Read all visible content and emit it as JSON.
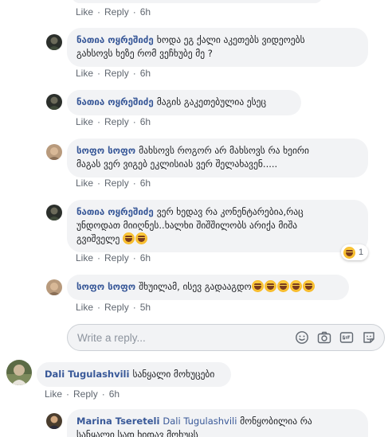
{
  "actions": {
    "like": "Like",
    "reply": "Reply",
    "separator": "·"
  },
  "top_comment_tail": {
    "time": "6h"
  },
  "comments": [
    {
      "author": "ნათია ოყრეშიძე",
      "line1": "ხოდა ეგ ქალი აკეთებს ვიდეოებს",
      "line2": "გახსოვს ხეზე რომ ვეჩხუბე მე ?",
      "time": "6h"
    },
    {
      "author": "ნათია ოყრეშიძე",
      "line1": "მაგის გაკეთებულია ესეც",
      "time": "6h"
    },
    {
      "author": "სოფო სოფო",
      "line1": "მახსოვს როგორ არ მახსოვს რა ხეირი",
      "line2": "მაგას ვერ ვიგებ ეკლისიას ვერ შელახავენ.....",
      "time": "6h"
    },
    {
      "author": "ნათია ოყრეშიძე",
      "line1": "ვერ ხედავ რა კონენტარებია,რაც",
      "line2": "უნდოდათ მიიღნეს..ხალხი შიშშილობს არიქა მიშა",
      "line3": "გვიშველე",
      "emoji_count_inline": 2,
      "reaction_count": "1",
      "time": "6h"
    },
    {
      "author": "სოფო სოფო",
      "line1": "შხუილამ, ისევ გადააგდო",
      "emoji_count_inline": 5,
      "time": "5h"
    }
  ],
  "reply_box": {
    "placeholder": "Write a reply..."
  },
  "dali": {
    "author": "Dali Tugulashvili",
    "text": "სანყალი მოხუცები",
    "time": "6h"
  },
  "marina": {
    "author": "Marina Tsereteli",
    "mention": "Dali Tugulashvili",
    "line1": "მონყობილია რა",
    "line2": "სანყალი სად ხიდავ მოხუცს"
  },
  "colors": {
    "link": "#385898",
    "meta": "#606770",
    "bubble": "#f2f3f5"
  }
}
